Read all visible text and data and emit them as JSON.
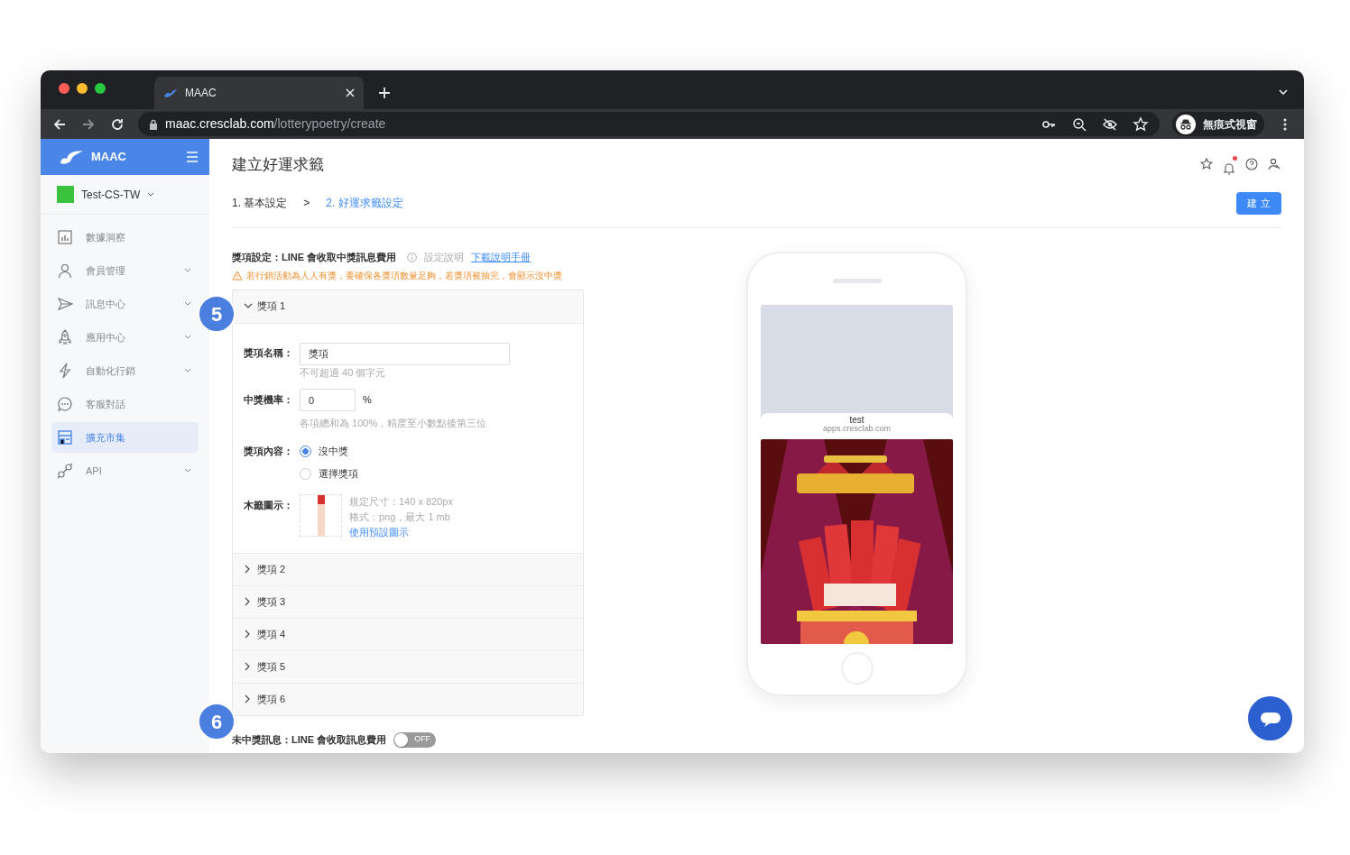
{
  "browser": {
    "tab_title": "MAAC",
    "url_host": "maac.cresclab.com",
    "url_path": "/lotterypoetry/create",
    "profile_label": "無痕式視窗"
  },
  "sidebar": {
    "brand": "MAAC",
    "account": "Test-CS-TW",
    "items": [
      {
        "label": "數據洞察",
        "kind": "chart",
        "expandable": false,
        "selected": false
      },
      {
        "label": "會員管理",
        "kind": "person",
        "expandable": true,
        "selected": false
      },
      {
        "label": "訊息中心",
        "kind": "send",
        "expandable": true,
        "selected": false
      },
      {
        "label": "應用中心",
        "kind": "rocket",
        "expandable": true,
        "selected": false
      },
      {
        "label": "自動化行銷",
        "kind": "bolt",
        "expandable": true,
        "selected": false
      },
      {
        "label": "客服對話",
        "kind": "chat",
        "expandable": false,
        "selected": false
      },
      {
        "label": "擴充市集",
        "kind": "store",
        "expandable": false,
        "selected": true
      },
      {
        "label": "API",
        "kind": "plug",
        "expandable": true,
        "selected": false
      }
    ]
  },
  "page": {
    "title": "建立好運求籤",
    "steps": [
      {
        "label": "1. 基本設定",
        "selected": false
      },
      {
        "label": "2. 好運求籤設定",
        "selected": true
      }
    ],
    "step_separator": ">",
    "create_button": "建 立",
    "notification_unread": true
  },
  "prize_settings": {
    "heading": "獎項設定：LINE 會收取中獎訊息費用",
    "help_label": "設定說明",
    "manual_link": "下載說明手冊",
    "warning": "若行銷活動為人人有獎，要確保各獎項數量足夠，若獎項被抽完，會顯示沒中獎"
  },
  "prizes": [
    {
      "title": "獎項 1",
      "expanded": true,
      "name_label": "獎項名稱：",
      "name_value": "獎項",
      "name_hint": "不可超過 40 個字元",
      "rate_label": "中獎機率：",
      "rate_value": "0",
      "rate_unit": "%",
      "rate_hint": "各項總和為 100%，精度至小數點後第三位",
      "content_label": "獎項內容：",
      "content_options": [
        {
          "label": "沒中獎",
          "selected": true
        },
        {
          "label": "選擇獎項",
          "selected": false
        }
      ],
      "icon_label": "木籤圖示：",
      "icon_specs": [
        "規定尺寸：140 x 820px",
        "格式：png，最大 1 mb"
      ],
      "icon_default_link": "使用預設圖示"
    },
    {
      "title": "獎項 2",
      "expanded": false
    },
    {
      "title": "獎項 3",
      "expanded": false
    },
    {
      "title": "獎項 4",
      "expanded": false
    },
    {
      "title": "獎項 5",
      "expanded": false
    },
    {
      "title": "獎項 6",
      "expanded": false
    }
  ],
  "no_win": {
    "label": "未中獎訊息：LINE 會收取訊息費用",
    "on": false,
    "toggle_text": "OFF"
  },
  "preview": {
    "title": "test",
    "domain": "apps.cresclab.com"
  },
  "annotations": [
    "5",
    "6"
  ]
}
